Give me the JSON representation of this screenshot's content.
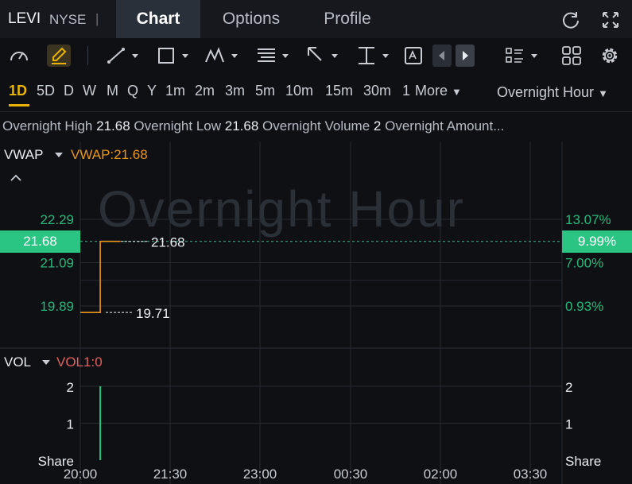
{
  "header": {
    "ticker": "LEVI",
    "exchange": "NYSE",
    "separator": "|",
    "tabs": [
      {
        "label": "Chart",
        "active": true
      },
      {
        "label": "Options"
      },
      {
        "label": "Profile"
      }
    ]
  },
  "timeframes": [
    "1D",
    "5D",
    "D",
    "W",
    "M",
    "Q",
    "Y",
    "1m",
    "2m",
    "3m",
    "5m",
    "10m",
    "15m",
    "30m",
    "1"
  ],
  "active_timeframe": "1D",
  "more_label": "More",
  "session_label": "Overnight Hour",
  "info": {
    "high_label": "Overnight High",
    "high": "21.68",
    "low_label": "Overnight Low",
    "low": "21.68",
    "volume_label": "Overnight Volume",
    "volume": "2",
    "amount_label": "Overnight Amount..."
  },
  "watermark": "Overnight Hour",
  "indicator": {
    "name": "VWAP",
    "value_text": "VWAP:21.68"
  },
  "volume_indicator": {
    "name": "VOL",
    "value_text": "VOL1:0"
  },
  "colors": {
    "accent": "#e8b400",
    "up": "#2ac483",
    "vwap": "#e8951c",
    "vol": "#e3605f"
  },
  "icons": [
    "refresh-icon",
    "fullscreen-icon",
    "gauge-icon",
    "pencil-icon",
    "line-tool-icon",
    "rectangle-tool-icon",
    "pattern-tool-icon",
    "fib-tool-icon",
    "arrow-tool-icon",
    "level-tool-icon",
    "text-tool-icon",
    "prev-icon",
    "next-icon",
    "list-layout-icon",
    "grid-layout-icon",
    "settings-icon"
  ],
  "chart_data": [
    {
      "type": "line",
      "title": "",
      "left_ticks": [
        "22.29",
        "21.09",
        "19.89"
      ],
      "right_ticks": [
        "13.07%",
        "7.00%",
        "0.93%"
      ],
      "current_price": "21.68",
      "current_pct": "9.99%",
      "annotations": [
        {
          "text": "21.68",
          "y": 21.68
        },
        {
          "text": "19.71",
          "y": 19.71
        }
      ],
      "x_ticks": [
        "20:00",
        "21:30",
        "23:00",
        "00:30",
        "02:00",
        "03:30"
      ],
      "series": [
        {
          "name": "VWAP",
          "points": [
            [
              "20:00",
              19.71
            ],
            [
              "20:20",
              19.71
            ],
            [
              "20:20",
              21.68
            ],
            [
              "20:40",
              21.68
            ]
          ]
        }
      ],
      "ylim": [
        19.5,
        22.55
      ]
    },
    {
      "type": "bar",
      "title": "",
      "left_ticks": [
        "2",
        "1",
        "Share"
      ],
      "right_ticks": [
        "2",
        "1",
        "Share"
      ],
      "x_ticks": [
        "20:00",
        "21:30",
        "23:00",
        "00:30",
        "02:00",
        "03:30"
      ],
      "series": [
        {
          "name": "VOL",
          "points": [
            [
              "20:20",
              2
            ]
          ]
        }
      ],
      "ylim": [
        0,
        2.6
      ]
    }
  ]
}
